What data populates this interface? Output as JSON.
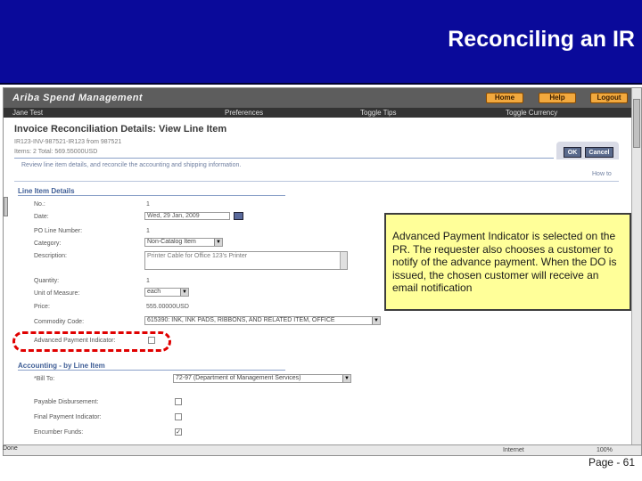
{
  "slide": {
    "title": "Reconciling an IR",
    "page_label": "Page - 61",
    "colors": {
      "title_band": "#0a0a9a",
      "callout_bg": "#ffff99",
      "highlight": "#e00000"
    }
  },
  "app": {
    "logo": "Ariba Spend Management",
    "nav_buttons": {
      "home": "Home",
      "help": "Help",
      "logout": "Logout"
    },
    "user_name": "Jane Test",
    "menu": {
      "preferences": "Preferences",
      "toggle_tips": "Toggle Tips",
      "toggle_currency": "Toggle Currency"
    }
  },
  "page": {
    "heading": "Invoice Reconciliation Details: View Line Item",
    "id_line": "IR123-INV-987521-IR123 from 987521",
    "items_line": "Items: 2    Total: 569.55000USD",
    "instruction": "Review line item details, and reconcile the accounting and shipping information.",
    "ok": "OK",
    "cancel": "Cancel",
    "how_to": "How to"
  },
  "line_item": {
    "section_title": "Line Item Details",
    "no_label": "No.:",
    "no_value": "1",
    "date_label": "Date:",
    "date_value": "Wed, 29 Jan, 2009",
    "po_line_label": "PO Line Number:",
    "po_line_value": "1",
    "category_label": "Category:",
    "category_value": "Non-Catalog Item",
    "description_label": "Description:",
    "description_value": "Printer Cable for Office 123's Printer",
    "quantity_label": "Quantity:",
    "quantity_value": "1",
    "uom_label": "Unit of Measure:",
    "uom_value": "each",
    "price_label": "Price:",
    "price_value": "555.00000USD",
    "commodity_label": "Commodity Code:",
    "commodity_value": "615390: INK, INK PADS, RIBBONS, AND RELATED ITEM, OFFICE",
    "adv_payment_label": "Advanced Payment Indicator:"
  },
  "accounting": {
    "section_title": "Accounting - by Line Item",
    "bill_to_label": "*Bill To:",
    "bill_to_value": "72-97 (Department of Management Services)",
    "payable_label": "Payable Disbursement:",
    "final_label": "Final Payment Indicator:",
    "encumber_label": "Encumber Funds:",
    "encumber_checked": "✓"
  },
  "callout": {
    "text": "Advanced Payment Indicator is selected on the PR.  The requester also chooses a customer to notify of the advance payment.  When the DO is issued, the chosen customer will receive an email notification"
  },
  "status": {
    "done": "Done",
    "zone": "Internet",
    "zoom": "100%"
  }
}
